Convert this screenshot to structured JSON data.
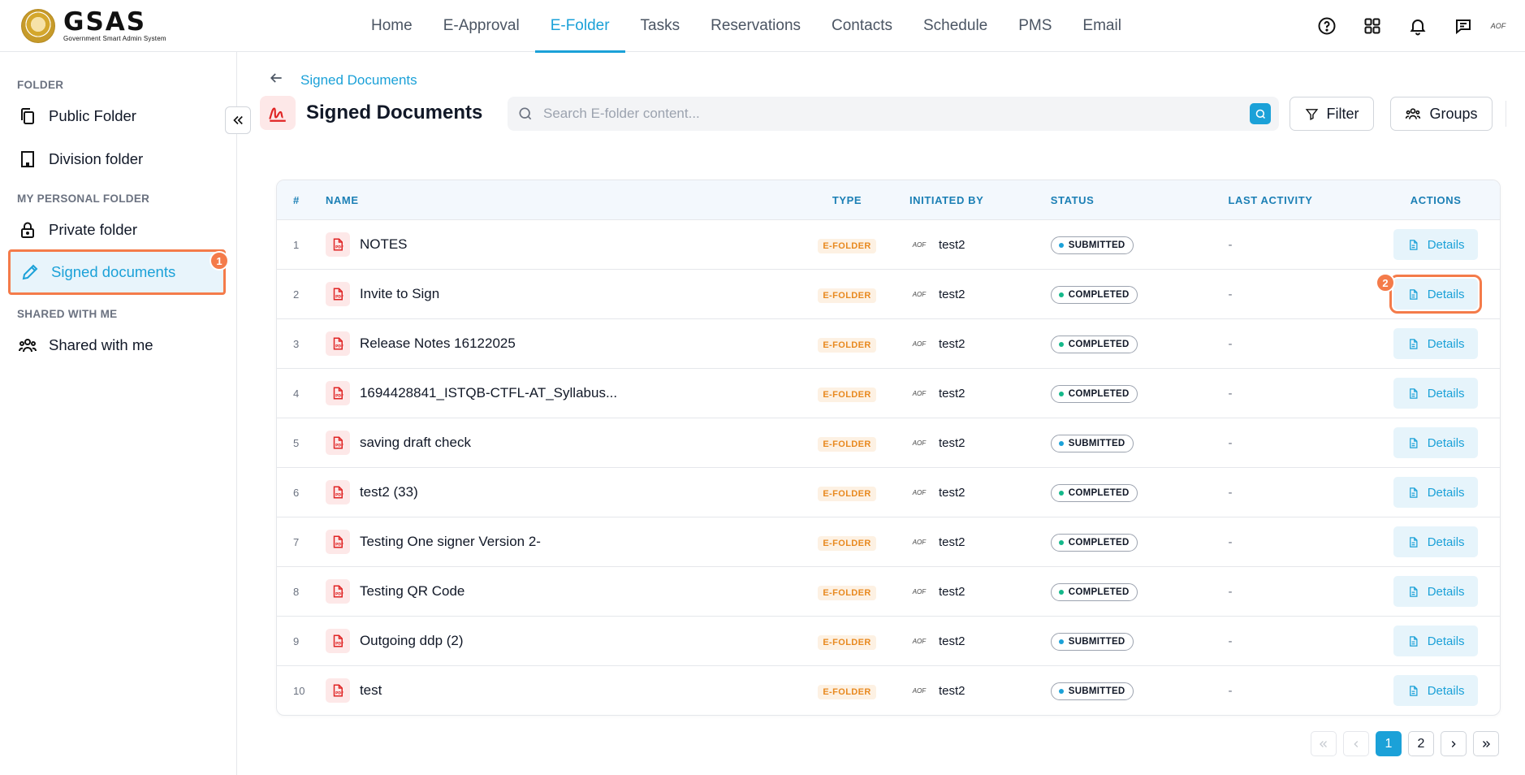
{
  "brand": {
    "name": "GSAS",
    "subtitle": "Government Smart Admin System"
  },
  "nav": {
    "items": [
      {
        "label": "Home"
      },
      {
        "label": "E-Approval"
      },
      {
        "label": "E-Folder",
        "active": true
      },
      {
        "label": "Tasks"
      },
      {
        "label": "Reservations"
      },
      {
        "label": "Contacts"
      },
      {
        "label": "Schedule"
      },
      {
        "label": "PMS"
      },
      {
        "label": "Email"
      }
    ],
    "icons": [
      "help-icon",
      "apps-grid-icon",
      "bell-icon",
      "chat-icon"
    ],
    "user_avatar": "AOF"
  },
  "sidebar": {
    "folder_heading": "FOLDER",
    "public_folder": "Public Folder",
    "division_folder": "Division folder",
    "personal_heading": "MY PERSONAL FOLDER",
    "private_folder": "Private folder",
    "signed_documents": "Signed documents",
    "shared_heading": "SHARED WITH ME",
    "shared_with_me": "Shared with me",
    "active_item": "Signed documents"
  },
  "annotations": {
    "badge_1": "1",
    "badge_2": "2"
  },
  "header": {
    "breadcrumb": "Signed Documents",
    "title": "Signed Documents",
    "search_placeholder": "Search E-folder content...",
    "filter_label": "Filter",
    "groups_label": "Groups"
  },
  "table": {
    "columns": {
      "num": "#",
      "name": "NAME",
      "type": "TYPE",
      "initiated_by": "INITIATED BY",
      "status": "STATUS",
      "last_activity": "LAST ACTIVITY",
      "actions": "ACTIONS"
    },
    "action_label": "Details",
    "rows": [
      {
        "num": "1",
        "name": "NOTES",
        "type": "E-FOLDER",
        "initiator_avatar": "AOF",
        "initiator": "test2",
        "status": "SUBMITTED",
        "last_activity": "-"
      },
      {
        "num": "2",
        "name": "Invite to Sign",
        "type": "E-FOLDER",
        "initiator_avatar": "AOF",
        "initiator": "test2",
        "status": "COMPLETED",
        "last_activity": "-"
      },
      {
        "num": "3",
        "name": "Release Notes 16122025",
        "type": "E-FOLDER",
        "initiator_avatar": "AOF",
        "initiator": "test2",
        "status": "COMPLETED",
        "last_activity": "-"
      },
      {
        "num": "4",
        "name": "1694428841_ISTQB-CTFL-AT_Syllabus...",
        "type": "E-FOLDER",
        "initiator_avatar": "AOF",
        "initiator": "test2",
        "status": "COMPLETED",
        "last_activity": "-"
      },
      {
        "num": "5",
        "name": "saving draft check",
        "type": "E-FOLDER",
        "initiator_avatar": "AOF",
        "initiator": "test2",
        "status": "SUBMITTED",
        "last_activity": "-"
      },
      {
        "num": "6",
        "name": "test2 (33)",
        "type": "E-FOLDER",
        "initiator_avatar": "AOF",
        "initiator": "test2",
        "status": "COMPLETED",
        "last_activity": "-"
      },
      {
        "num": "7",
        "name": "Testing One signer Version 2-",
        "type": "E-FOLDER",
        "initiator_avatar": "AOF",
        "initiator": "test2",
        "status": "COMPLETED",
        "last_activity": "-"
      },
      {
        "num": "8",
        "name": "Testing QR Code",
        "type": "E-FOLDER",
        "initiator_avatar": "AOF",
        "initiator": "test2",
        "status": "COMPLETED",
        "last_activity": "-"
      },
      {
        "num": "9",
        "name": "Outgoing ddp (2)",
        "type": "E-FOLDER",
        "initiator_avatar": "AOF",
        "initiator": "test2",
        "status": "SUBMITTED",
        "last_activity": "-"
      },
      {
        "num": "10",
        "name": "test",
        "type": "E-FOLDER",
        "initiator_avatar": "AOF",
        "initiator": "test2",
        "status": "SUBMITTED",
        "last_activity": "-"
      }
    ]
  },
  "pagination": {
    "pages": [
      "1",
      "2"
    ],
    "current": "1"
  },
  "colors": {
    "accent": "#1ba1d8",
    "annotation": "#f47b4a",
    "type_badge": "#e8891f",
    "completed_dot": "#14b88a",
    "submitted_dot": "#1ba1d8"
  }
}
